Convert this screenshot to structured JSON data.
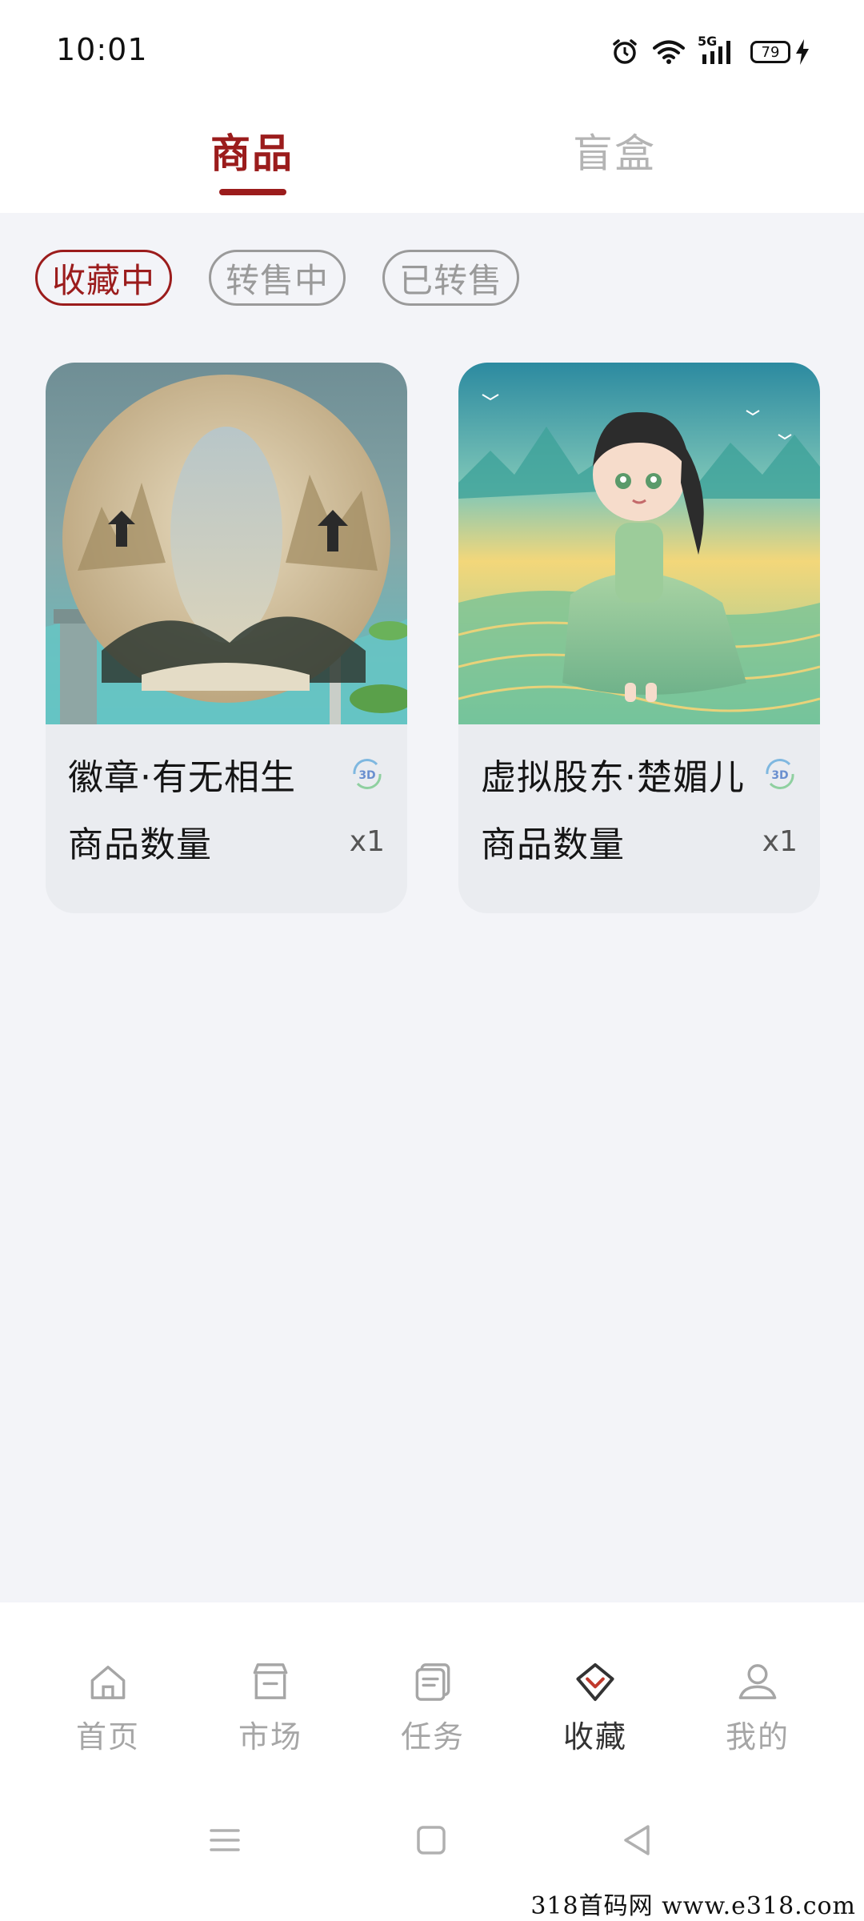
{
  "status_bar": {
    "time": "10:01",
    "network": "5G",
    "battery": "79",
    "icons": [
      "alarm-icon",
      "wifi-icon",
      "signal-5g-icon",
      "battery-icon",
      "charging-icon"
    ]
  },
  "top_tabs": [
    {
      "label": "商品",
      "active": true
    },
    {
      "label": "盲盒",
      "active": false
    }
  ],
  "filters": [
    {
      "label": "收藏中",
      "active": true
    },
    {
      "label": "转售中",
      "active": false
    },
    {
      "label": "已转售",
      "active": false
    }
  ],
  "cards": [
    {
      "title": "徽章·有无相生",
      "qty_label": "商品数量",
      "qty_value": "x1",
      "badge": "3D",
      "image_icon": "landscape-badge-image"
    },
    {
      "title": "虚拟股东·楚媚儿",
      "qty_label": "商品数量",
      "qty_value": "x1",
      "badge": "3D",
      "image_icon": "character-illustration-image"
    }
  ],
  "bottom_nav": [
    {
      "label": "首页",
      "icon": "home-icon",
      "active": false
    },
    {
      "label": "市场",
      "icon": "store-icon",
      "active": false
    },
    {
      "label": "任务",
      "icon": "task-icon",
      "active": false
    },
    {
      "label": "收藏",
      "icon": "collection-icon",
      "active": true
    },
    {
      "label": "我的",
      "icon": "profile-icon",
      "active": false
    }
  ],
  "watermark": "318首码网 www.e318.com",
  "colors": {
    "accent": "#9b1c1c",
    "inactive": "#a6a6a6",
    "content_bg": "#f3f4f8",
    "card_bg": "#eaecf0"
  }
}
